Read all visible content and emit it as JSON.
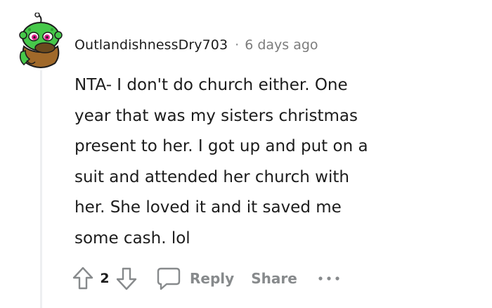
{
  "comment": {
    "author": "OutlandishnessDry703",
    "separator": "·",
    "time_ago": "6 days ago",
    "body": "NTA- I don't do church either. One\nyear that was my sisters christmas\npresent to her. I got up and put on a\nsuit and attended her church with\nher. She loved it and it saved me\nsome cash. lol",
    "avatar_icon": "snoo-avatar-icon"
  },
  "actions": {
    "upvote_icon": "upvote-arrow-icon",
    "vote_count": "2",
    "downvote_icon": "downvote-arrow-icon",
    "reply_icon": "speech-bubble-icon",
    "reply_label": "Reply",
    "share_label": "Share",
    "more_icon": "more-options-icon"
  },
  "colors": {
    "text": "#1c1c1c",
    "muted": "#878a8c",
    "thread_line": "#edeff1",
    "avatar_green": "#46c84a",
    "avatar_brown": "#a0692a"
  }
}
